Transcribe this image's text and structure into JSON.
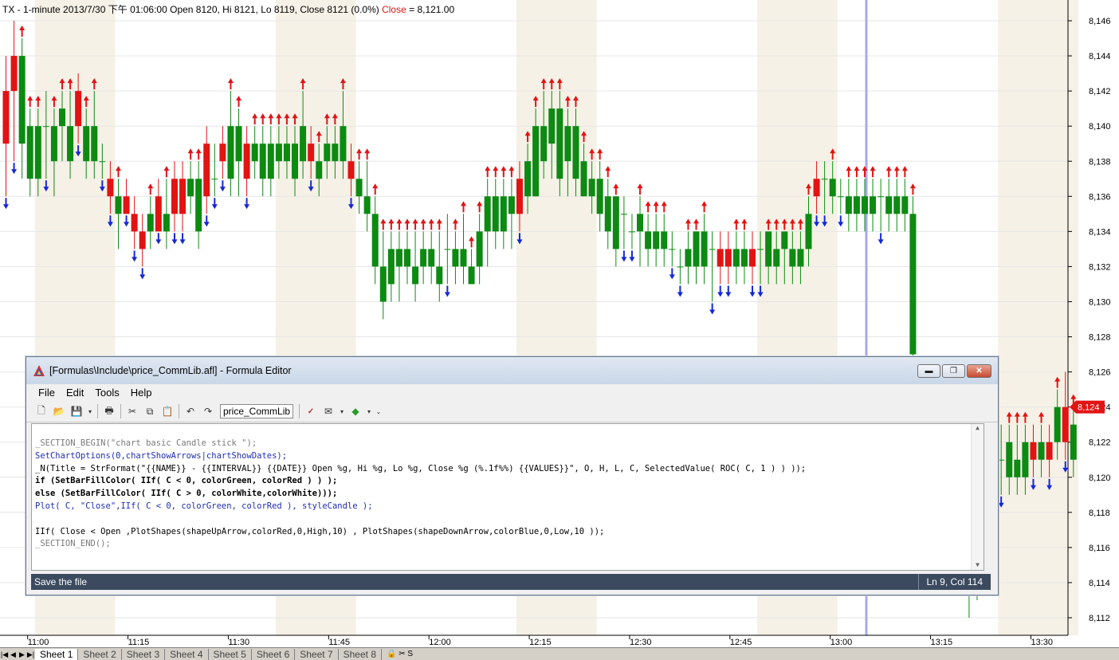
{
  "chart": {
    "title_prefix": "TX - 1-minute 2013/7/30 下午 01:06:00 Open 8120, Hi 8121, Lo 8119, Close 8121 (0.0%)",
    "title_close_label": "Close",
    "title_close_value": " = 8,121.00",
    "current_price_label": "8,124",
    "y_axis_labels": [
      "8,146",
      "8,144",
      "8,142",
      "8,140",
      "8,138",
      "8,136",
      "8,134",
      "8,132",
      "8,130",
      "8,128",
      "8,126",
      "8,124",
      "8,122",
      "8,120",
      "8,118",
      "8,116",
      "8,114",
      "8,112"
    ],
    "x_axis_labels": [
      "11:00",
      "11:15",
      "11:30",
      "11:45",
      "12:00",
      "12:15",
      "12:30",
      "12:45",
      "13:00",
      "13:15",
      "13:30"
    ],
    "colors": {
      "up": "#e21313",
      "down": "#0c8a12",
      "arrow_up": "#e21313",
      "arrow_down": "#1428d6",
      "price_tag": "#e21313",
      "band": "#f6f1e6"
    }
  },
  "chart_data": {
    "type": "bar",
    "series_type": "candlestick",
    "x_labels": [
      "11:00",
      "11:15",
      "11:30",
      "11:45",
      "12:00",
      "12:15",
      "12:30",
      "12:45",
      "13:00",
      "13:15",
      "13:30"
    ],
    "ylim": [
      8111,
      8147
    ],
    "bars": [
      [
        0,
        8139,
        8142,
        8136,
        8144
      ],
      [
        1,
        8142,
        8144,
        8138,
        8146
      ],
      [
        2,
        8144,
        8139,
        8137,
        8145
      ],
      [
        3,
        8140,
        8137,
        8136,
        8141
      ],
      [
        4,
        8140,
        8137,
        8136,
        8141
      ],
      [
        5,
        8140,
        8140,
        8137,
        8142
      ],
      [
        6,
        8140,
        8138,
        8136,
        8141
      ],
      [
        7,
        8141,
        8140,
        8138,
        8142
      ],
      [
        8,
        8140,
        8138,
        8137,
        8142
      ],
      [
        9,
        8140,
        8142,
        8139,
        8143
      ],
      [
        10,
        8140,
        8138,
        8137,
        8141
      ],
      [
        11,
        8140,
        8138,
        8137,
        8142
      ],
      [
        12,
        8138,
        8138,
        8137,
        8139
      ],
      [
        13,
        8136,
        8137,
        8135,
        8138
      ],
      [
        14,
        8136,
        8135,
        8133,
        8137
      ],
      [
        15,
        8135,
        8136,
        8135,
        8137
      ],
      [
        16,
        8134,
        8135,
        8133,
        8136
      ],
      [
        17,
        8133,
        8134,
        8132,
        8135
      ],
      [
        18,
        8135,
        8134,
        8133,
        8136
      ],
      [
        19,
        8134,
        8136,
        8134,
        8137
      ],
      [
        20,
        8135,
        8134,
        8133,
        8137
      ],
      [
        21,
        8135,
        8137,
        8134,
        8138
      ],
      [
        22,
        8135,
        8137,
        8134,
        8138
      ],
      [
        23,
        8137,
        8136,
        8135,
        8138
      ],
      [
        24,
        8137,
        8134,
        8133,
        8138
      ],
      [
        25,
        8136,
        8139,
        8135,
        8140
      ],
      [
        26,
        8137,
        8137,
        8136,
        8139
      ],
      [
        27,
        8138,
        8139,
        8137,
        8140
      ],
      [
        28,
        8140,
        8137,
        8136,
        8142
      ],
      [
        29,
        8140,
        8138,
        8136,
        8141
      ],
      [
        30,
        8137,
        8139,
        8136,
        8140
      ],
      [
        31,
        8139,
        8138,
        8137,
        8140
      ],
      [
        32,
        8139,
        8137,
        8136,
        8140
      ],
      [
        33,
        8139,
        8137,
        8136,
        8140
      ],
      [
        34,
        8139,
        8138,
        8137,
        8140
      ],
      [
        35,
        8139,
        8138,
        8137,
        8140
      ],
      [
        36,
        8139,
        8137,
        8136,
        8140
      ],
      [
        37,
        8140,
        8138,
        8137,
        8142
      ],
      [
        38,
        8138,
        8139,
        8137,
        8140
      ],
      [
        39,
        8138,
        8137,
        8136,
        8139
      ],
      [
        40,
        8139,
        8138,
        8137,
        8140
      ],
      [
        41,
        8139,
        8138,
        8137,
        8140
      ],
      [
        42,
        8140,
        8138,
        8137,
        8142
      ],
      [
        43,
        8137,
        8138,
        8136,
        8139
      ],
      [
        44,
        8137,
        8136,
        8135,
        8138
      ],
      [
        45,
        8136,
        8135,
        8134,
        8138
      ],
      [
        46,
        8135,
        8132,
        8131,
        8136
      ],
      [
        47,
        8132,
        8130,
        8129,
        8134
      ],
      [
        48,
        8133,
        8131,
        8130,
        8134
      ],
      [
        49,
        8133,
        8132,
        8130,
        8134
      ],
      [
        50,
        8133,
        8132,
        8131,
        8134
      ],
      [
        51,
        8132,
        8131,
        8130,
        8134
      ],
      [
        52,
        8133,
        8132,
        8131,
        8134
      ],
      [
        53,
        8133,
        8132,
        8131,
        8134
      ],
      [
        54,
        8132,
        8131,
        8130,
        8134
      ],
      [
        55,
        8133,
        8133,
        8131,
        8135
      ],
      [
        56,
        8133,
        8132,
        8131,
        8134
      ],
      [
        57,
        8133,
        8132,
        8131,
        8135
      ],
      [
        58,
        8132,
        8131,
        8131,
        8133
      ],
      [
        59,
        8134,
        8132,
        8131,
        8135
      ],
      [
        60,
        8136,
        8134,
        8132,
        8137
      ],
      [
        61,
        8136,
        8134,
        8133,
        8137
      ],
      [
        62,
        8136,
        8134,
        8133,
        8137
      ],
      [
        63,
        8136,
        8135,
        8133,
        8137
      ],
      [
        64,
        8135,
        8137,
        8134,
        8138
      ],
      [
        65,
        8138,
        8136,
        8135,
        8139
      ],
      [
        66,
        8140,
        8136,
        8136,
        8141
      ],
      [
        67,
        8140,
        8138,
        8137,
        8142
      ],
      [
        68,
        8141,
        8139,
        8137,
        8142
      ],
      [
        69,
        8141,
        8137,
        8136,
        8142
      ],
      [
        70,
        8140,
        8138,
        8136,
        8141
      ],
      [
        71,
        8140,
        8137,
        8136,
        8141
      ],
      [
        72,
        8138,
        8136,
        8136,
        8139
      ],
      [
        73,
        8137,
        8136,
        8135,
        8138
      ],
      [
        74,
        8137,
        8135,
        8134,
        8138
      ],
      [
        75,
        8136,
        8134,
        8133,
        8137
      ],
      [
        76,
        8136,
        8133,
        8132,
        8136
      ],
      [
        77,
        8135,
        8135,
        8133,
        8136
      ],
      [
        78,
        8134,
        8134,
        8133,
        8135
      ],
      [
        79,
        8135,
        8134,
        8132,
        8136
      ],
      [
        80,
        8134,
        8133,
        8132,
        8135
      ],
      [
        81,
        8134,
        8133,
        8132,
        8135
      ],
      [
        82,
        8134,
        8133,
        8132,
        8135
      ],
      [
        83,
        8133,
        8133,
        8132,
        8134
      ],
      [
        84,
        8132,
        8132,
        8131,
        8133
      ],
      [
        85,
        8133,
        8132,
        8131,
        8134
      ],
      [
        86,
        8134,
        8132,
        8131,
        8134
      ],
      [
        87,
        8134,
        8132,
        8131,
        8135
      ],
      [
        88,
        8133,
        8133,
        8130,
        8134
      ],
      [
        89,
        8132,
        8133,
        8131,
        8134
      ],
      [
        90,
        8132,
        8133,
        8131,
        8134
      ],
      [
        91,
        8133,
        8132,
        8131,
        8134
      ],
      [
        92,
        8133,
        8132,
        8131,
        8134
      ],
      [
        93,
        8132,
        8133,
        8131,
        8134
      ],
      [
        94,
        8133,
        8133,
        8131,
        8134
      ],
      [
        95,
        8134,
        8132,
        8131,
        8134
      ],
      [
        96,
        8133,
        8132,
        8131,
        8134
      ],
      [
        97,
        8134,
        8133,
        8131,
        8134
      ],
      [
        98,
        8133,
        8132,
        8131,
        8134
      ],
      [
        99,
        8133,
        8132,
        8131,
        8134
      ],
      [
        100,
        8135,
        8133,
        8132,
        8136
      ],
      [
        101,
        8136,
        8137,
        8135,
        8138
      ],
      [
        102,
        8137,
        8137,
        8135,
        8138
      ],
      [
        103,
        8137,
        8136,
        8135,
        8138
      ],
      [
        104,
        8136,
        8136,
        8135,
        8137
      ],
      [
        105,
        8136,
        8135,
        8134,
        8137
      ],
      [
        106,
        8136,
        8135,
        8134,
        8137
      ],
      [
        107,
        8136,
        8135,
        8134,
        8137
      ],
      [
        108,
        8136,
        8135,
        8134,
        8137
      ],
      [
        109,
        8136,
        8136,
        8134,
        8137
      ],
      [
        110,
        8136,
        8135,
        8134,
        8137
      ],
      [
        111,
        8136,
        8135,
        8134,
        8137
      ],
      [
        112,
        8136,
        8135,
        8134,
        8137
      ],
      [
        113,
        8135,
        8127,
        8126,
        8136
      ],
      [
        119,
        8125,
        8116,
        8114,
        8126
      ],
      [
        120,
        8117,
        8114,
        8112,
        8119
      ],
      [
        121,
        8118,
        8114,
        8113,
        8119
      ],
      [
        122,
        8118,
        8116,
        8114,
        8119
      ],
      [
        123,
        8121,
        8122,
        8119,
        8123
      ],
      [
        124,
        8121,
        8121,
        8119,
        8123
      ],
      [
        125,
        8122,
        8120,
        8119,
        8123
      ],
      [
        126,
        8121,
        8120,
        8119,
        8123
      ],
      [
        127,
        8122,
        8120,
        8119,
        8123
      ],
      [
        128,
        8121,
        8122,
        8120,
        8123
      ],
      [
        129,
        8122,
        8121,
        8120,
        8123
      ],
      [
        130,
        8121,
        8122,
        8120,
        8123
      ],
      [
        131,
        8124,
        8122,
        8121,
        8125
      ],
      [
        132,
        8122,
        8124,
        8121,
        8126
      ],
      [
        133,
        8123,
        8121,
        8120,
        8124
      ]
    ]
  },
  "editor": {
    "title": "[Formulas\\Include\\price_CommLib.afl] - Formula Editor",
    "menus": [
      "File",
      "Edit",
      "Tools",
      "Help"
    ],
    "file_combo": "price_CommLib",
    "code_lines": [
      {
        "t": "_SECTION_BEGIN(\"chart basic Candle stick \");",
        "c": "sec"
      },
      {
        "t": "SetChartOptions(0,chartShowArrows|chartShowDates);",
        "c": "fn"
      },
      {
        "t": "_N(Title = StrFormat(\"{{NAME}} - {{INTERVAL}} {{DATE}} Open %g, Hi %g, Lo %g, Close %g (%.1f%%) {{VALUES}}\", O, H, L, C, SelectedValue( ROC( C, 1 ) ) ));",
        "c": "pl"
      },
      {
        "t": "if (SetBarFillColor( IIf( C < 0, colorGreen, colorRed ) ) );",
        "c": "kw"
      },
      {
        "t": "else (SetBarFillColor( IIf( C > 0, colorWhite,colorWhite)));",
        "c": "kw"
      },
      {
        "t": "Plot( C, \"Close\",IIf( C < 0, colorGreen, colorRed ), styleCandle );",
        "c": "fn"
      },
      {
        "t": "",
        "c": "pl"
      },
      {
        "t": "IIf( Close < Open ,PlotShapes(shapeUpArrow,colorRed,0,High,10) , PlotShapes(shapeDownArrow,colorBlue,0,Low,10 ));",
        "c": "pl"
      },
      {
        "t": "_SECTION_END();",
        "c": "sec"
      }
    ],
    "status_message": "Save the file",
    "cursor_position": "Ln 9, Col 114"
  },
  "sheets": [
    "Sheet 1",
    "Sheet 2",
    "Sheet 3",
    "Sheet 4",
    "Sheet 5",
    "Sheet 6",
    "Sheet 7",
    "Sheet 8"
  ],
  "sheet_nav": [
    "|◀",
    "◀",
    "▶",
    "▶|"
  ],
  "sheet_extra": "🔒 ✂ S"
}
